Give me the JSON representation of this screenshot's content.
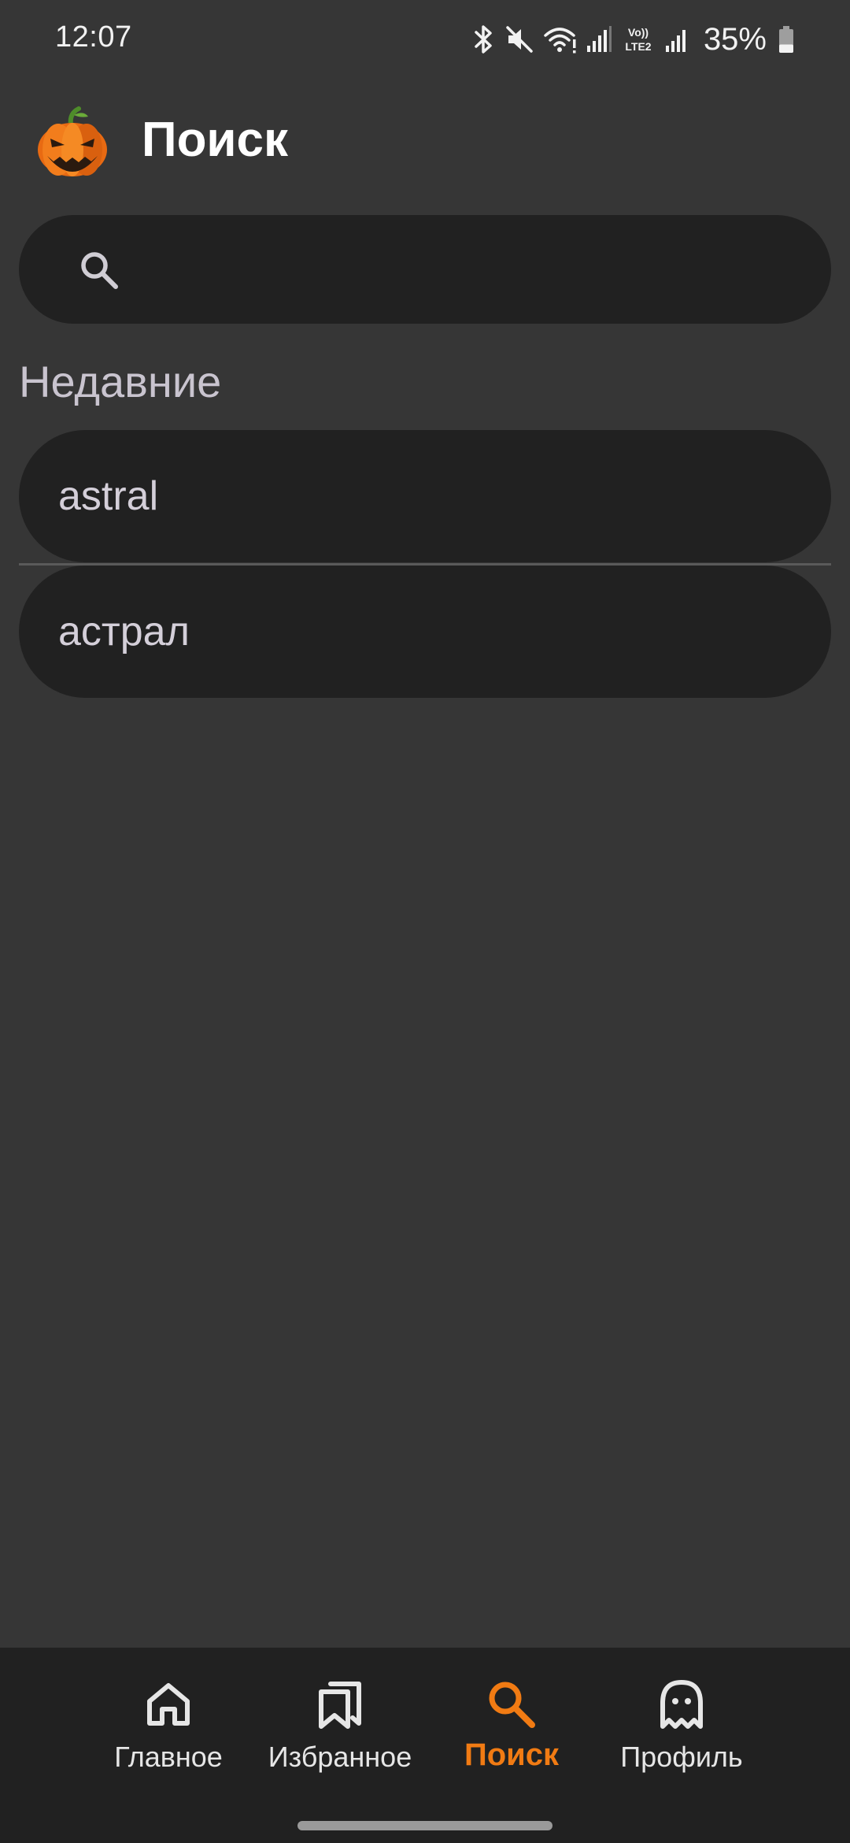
{
  "status_bar": {
    "time": "12:07",
    "battery_percent": "35%",
    "battery_level": 0.35,
    "lte_label_top": "Vo))",
    "lte_label_bottom": "LTE2",
    "icons": [
      "bluetooth-icon",
      "mute-icon",
      "wifi-icon",
      "signal-icon",
      "volte-icon",
      "signal-icon",
      "battery-icon"
    ]
  },
  "header": {
    "logo_icon": "pumpkin-logo-icon",
    "title": "Поиск"
  },
  "search": {
    "icon": "search-icon",
    "value": "",
    "placeholder": ""
  },
  "recent": {
    "title": "Недавние",
    "items": [
      {
        "label": "astral"
      },
      {
        "label": "астрал"
      }
    ]
  },
  "bottom_nav": {
    "accent_color": "#f17b13",
    "items": [
      {
        "label": "Главное",
        "icon": "home-icon",
        "active": false
      },
      {
        "label": "Избранное",
        "icon": "bookmarks-icon",
        "active": false
      },
      {
        "label": "Поиск",
        "icon": "search-icon",
        "active": true
      },
      {
        "label": "Профиль",
        "icon": "ghost-icon",
        "active": false
      }
    ]
  }
}
